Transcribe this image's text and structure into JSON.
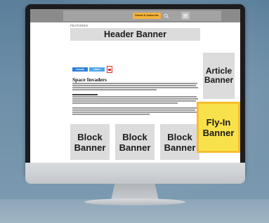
{
  "navbar": {
    "cta_label": "Renew & Subscribe"
  },
  "page": {
    "section_label": "FEATURES",
    "article_title": "Space Invaders"
  },
  "share": {
    "facebook_label": "f SHARE",
    "twitter_label": "TWEET"
  },
  "banners": {
    "header": "Header Banner",
    "article": "Article Banner",
    "flyin": "Fly-In Banner",
    "block_1": "Block Banner",
    "block_2": "Block Banner",
    "block_3": "Block Banner"
  },
  "colors": {
    "navbar": "#8b8b8b",
    "cta": "#f4b33a",
    "banner_placeholder": "#dcdcdc",
    "flyin_fill": "#f8e24b",
    "flyin_border": "#f5be2e",
    "share_facebook": "#2d7fd6",
    "share_twitter": "#4fa8e8"
  },
  "icons": {
    "search": "search-icon",
    "menu": "hamburger-menu-icon",
    "pdf": "pdf-icon"
  }
}
